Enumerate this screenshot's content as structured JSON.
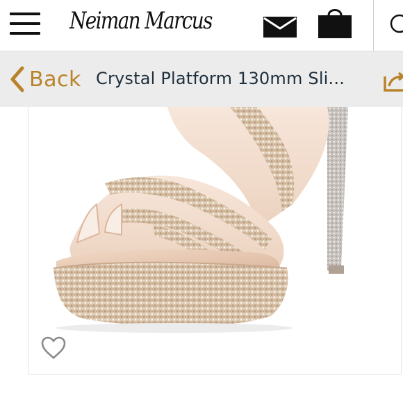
{
  "header": {
    "brand_name": "Neiman Marcus",
    "menu_icon": "hamburger-menu-icon",
    "mail_icon": "envelope-icon",
    "bag_icon": "shopping-bag-icon",
    "search_icon": "search-icon"
  },
  "subnav": {
    "back_label": "Back",
    "product_title": "Crystal Platform 130mm Sli...",
    "share_icon": "share-icon"
  },
  "product": {
    "image_alt": "crystal platform sandal",
    "favorite_icon": "heart-icon"
  },
  "colors": {
    "accent_gold": "#b8832a",
    "title_navy": "#1e2f3d",
    "subnav_bg": "#ececec"
  }
}
